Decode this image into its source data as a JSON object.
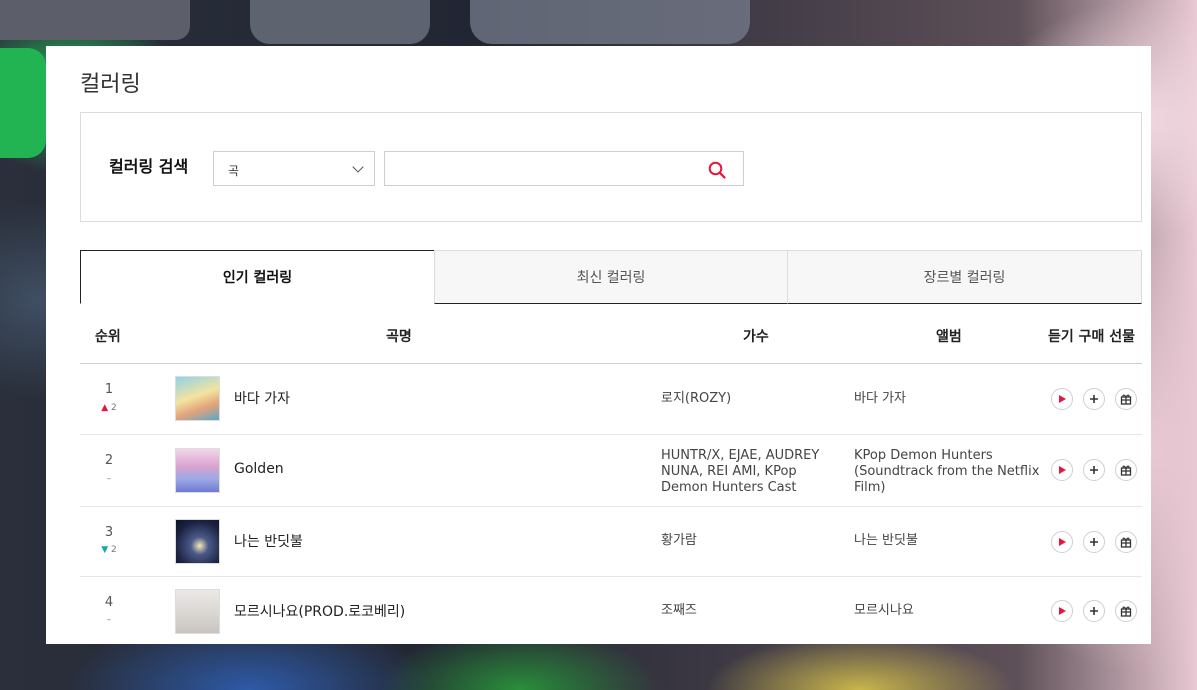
{
  "page": {
    "title": "컬러링"
  },
  "search": {
    "label": "컬러링 검색",
    "category_selected": "곡",
    "query_value": "",
    "query_placeholder": ""
  },
  "tabs": [
    {
      "label": "인기 컬러링",
      "active": true
    },
    {
      "label": "최신 컬러링",
      "active": false
    },
    {
      "label": "장르별 컬러링",
      "active": false
    }
  ],
  "table": {
    "headers": {
      "rank": "순위",
      "title": "곡명",
      "artist": "가수",
      "album": "앨범",
      "actions": "듣기 구매 선물"
    },
    "rows": [
      {
        "rank": "1",
        "change_dir": "up",
        "change": "2",
        "title": "바다 가자",
        "artist": "로지(ROZY)",
        "album": "바다 가자"
      },
      {
        "rank": "2",
        "change_dir": "none",
        "change": "–",
        "title": "Golden",
        "artist": "HUNTR/X, EJAE, AUDREY NUNA, REI AMI, KPop Demon Hunters Cast",
        "album": "KPop Demon Hunters (Soundtrack from the Netflix Film)"
      },
      {
        "rank": "3",
        "change_dir": "down",
        "change": "2",
        "title": "나는 반딧불",
        "artist": "황가람",
        "album": "나는 반딧불"
      },
      {
        "rank": "4",
        "change_dir": "none",
        "change": "–",
        "title": "모르시나요(PROD.로코베리)",
        "artist": "조째즈",
        "album": "모르시나요"
      }
    ]
  },
  "colors": {
    "accent": "#e8143c",
    "down": "#17a5b5",
    "border": "#dcdcdc"
  }
}
